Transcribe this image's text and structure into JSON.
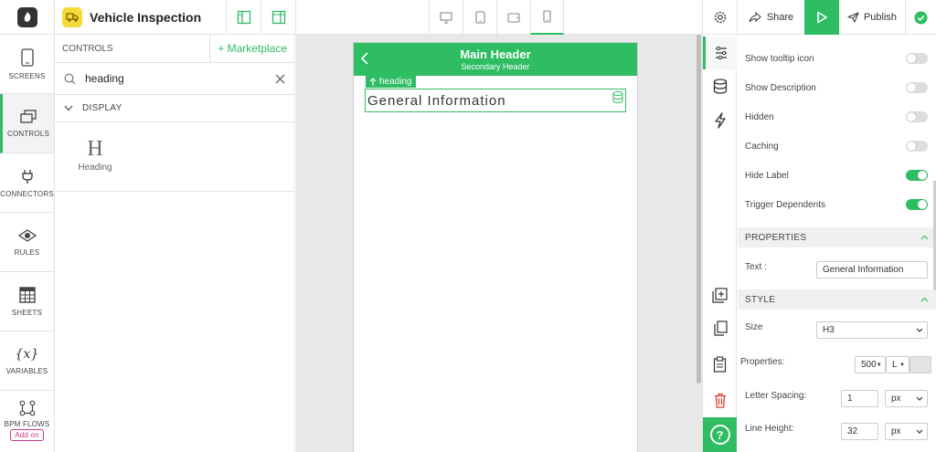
{
  "app": {
    "title": "Vehicle Inspection"
  },
  "topbar": {
    "share_label": "Share",
    "publish_label": "Publish",
    "devices": [
      "desktop-icon",
      "tablet-icon",
      "tablet-landscape-icon",
      "mobile-icon"
    ],
    "active_device": "mobile"
  },
  "rail": {
    "items": [
      {
        "label": "SCREENS",
        "icon": "screens-icon"
      },
      {
        "label": "CONTROLS",
        "icon": "controls-icon",
        "active": true
      },
      {
        "label": "CONNECTORS",
        "icon": "plug-icon"
      },
      {
        "label": "RULES",
        "icon": "eye-icon"
      },
      {
        "label": "SHEETS",
        "icon": "grid-icon"
      },
      {
        "label": "VARIABLES",
        "icon": "variable-icon"
      },
      {
        "label": "BPM FLOWS",
        "icon": "flow-icon"
      }
    ],
    "addon_label": "Add on"
  },
  "controls": {
    "title": "CONTROLS",
    "marketplace_label": "+ Marketplace",
    "search_value": "heading",
    "section_label": "DISPLAY",
    "tiles": [
      {
        "glyph": "H",
        "label": "Heading"
      }
    ]
  },
  "canvas": {
    "main_header": "Main Header",
    "secondary_header": "Secondary Header",
    "selected_tag": "heading",
    "heading_text": "General Information"
  },
  "props": {
    "toggles": [
      {
        "label": "Show tooltip icon",
        "on": false
      },
      {
        "label": "Show Description",
        "on": false
      },
      {
        "label": "Hidden",
        "on": false
      },
      {
        "label": "Caching",
        "on": false
      },
      {
        "label": "Hide Label",
        "on": true
      },
      {
        "label": "Trigger Dependents",
        "on": true
      }
    ],
    "properties_section": "PROPERTIES",
    "text_label": "Text :",
    "text_value": "General Information",
    "style_section": "STYLE",
    "size_label": "Size",
    "size_value": "H3",
    "properties_label": "Properties:",
    "weight_value": "500",
    "align_value": "L",
    "letter_spacing_label": "Letter Spacing:",
    "letter_spacing_value": "1",
    "letter_spacing_unit": "px",
    "line_height_label": "Line Height:",
    "line_height_value": "32",
    "line_height_unit": "px"
  },
  "colors": {
    "accent": "#2ebd63",
    "addon": "#c43b8a",
    "brand_badge": "#f7d93a"
  }
}
